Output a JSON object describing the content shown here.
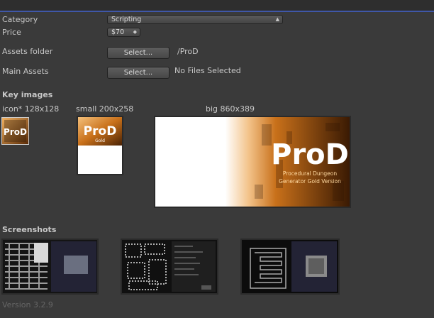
{
  "form": {
    "category_label": "Category",
    "category_value": "Scripting",
    "price_label": "Price",
    "price_value": "$70",
    "assets_folder_label": "Assets folder",
    "assets_folder_button": "Select...",
    "assets_folder_value": "/ProD",
    "main_assets_label": "Main Assets",
    "main_assets_button": "Select...",
    "main_assets_value": "No Files Selected"
  },
  "key_images": {
    "heading": "Key images",
    "icon_label": "icon* 128x128",
    "small_label": "small 200x258",
    "big_label": "big 860x389",
    "logo_text": "ProD",
    "logo_subtext": "Gold",
    "big_subtitle_1": "Procedural Dungeon",
    "big_subtitle_2": "Generator Gold Version"
  },
  "screenshots": {
    "heading": "Screenshots"
  },
  "footer": {
    "version": "Version 3.2.9"
  },
  "colors": {
    "accent": "#3f57a8",
    "logo_orange": "#c8701a"
  }
}
